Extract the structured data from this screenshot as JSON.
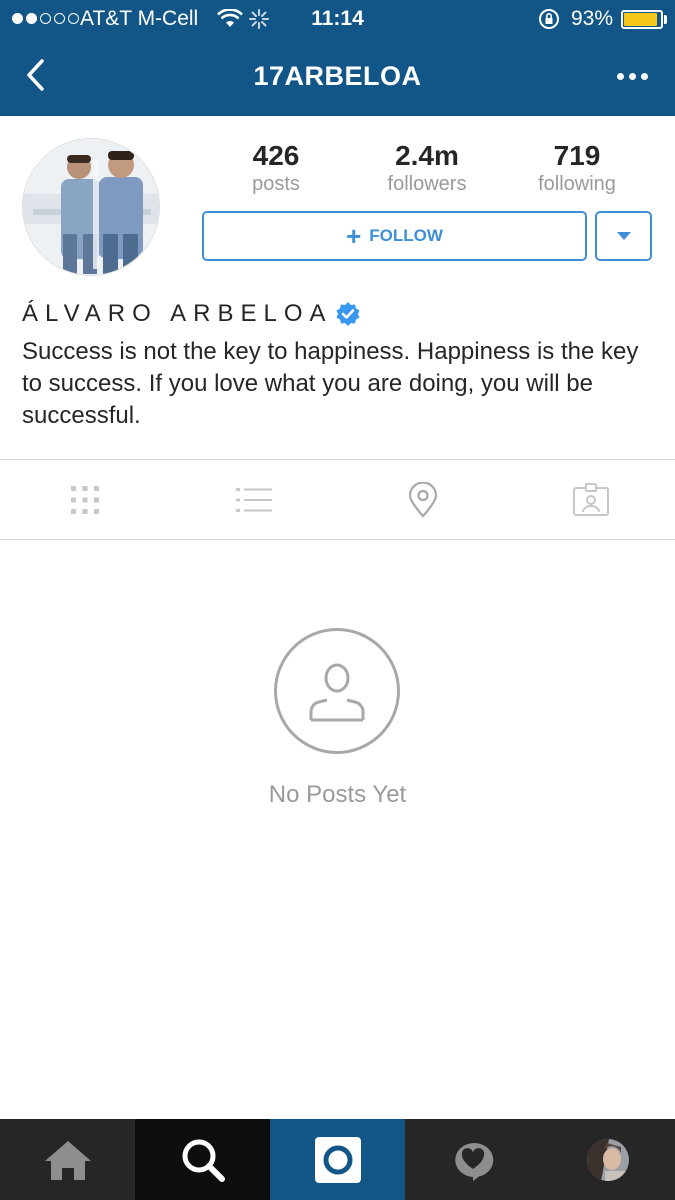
{
  "status_bar": {
    "carrier": "AT&T M-Cell",
    "time": "11:14",
    "battery_percent": "93%",
    "battery_level": 0.93,
    "signal_bars": 2
  },
  "nav": {
    "title": "17ARBELOA"
  },
  "profile": {
    "stats": [
      {
        "value": "426",
        "label": "posts"
      },
      {
        "value": "2.4m",
        "label": "followers"
      },
      {
        "value": "719",
        "label": "following"
      }
    ],
    "follow_label": "FOLLOW",
    "full_name": "ÁLVARO ARBELOA",
    "bio": "Success is not the key to happiness. Happiness is the key to success. If you love what you are doing, you will be successful."
  },
  "tabs": [
    {
      "icon": "grid-icon"
    },
    {
      "icon": "list-icon"
    },
    {
      "icon": "location-pin-icon"
    },
    {
      "icon": "tagged-photos-icon"
    }
  ],
  "empty_state": {
    "message": "No Posts Yet"
  },
  "bottom_nav": [
    {
      "icon": "home-icon"
    },
    {
      "icon": "search-icon",
      "active": true
    },
    {
      "icon": "camera-icon"
    },
    {
      "icon": "activity-heart-icon"
    },
    {
      "icon": "profile-avatar"
    }
  ],
  "colors": {
    "brand_blue": "#125688",
    "follow_blue": "#3f8fd8",
    "battery_yellow": "#f7c81c",
    "verified_blue": "#3897f0"
  }
}
